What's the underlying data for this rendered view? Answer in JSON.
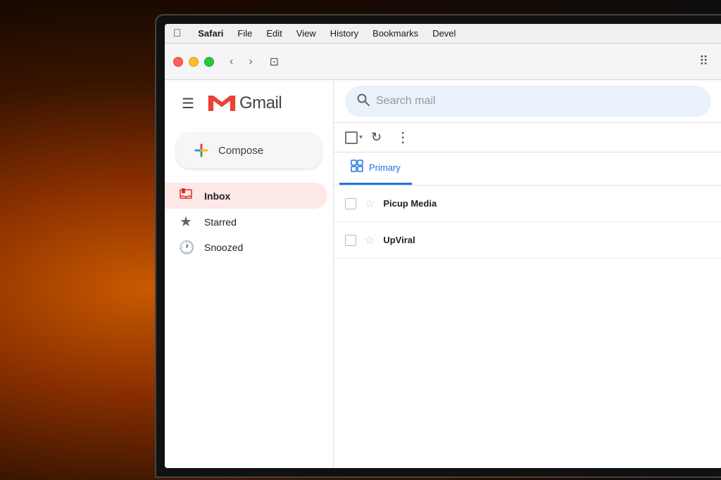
{
  "background": {
    "description": "warm fire glow background"
  },
  "menubar": {
    "apple_symbol": "&#xF8FF;",
    "items": [
      {
        "label": "Safari",
        "bold": true
      },
      {
        "label": "File"
      },
      {
        "label": "Edit"
      },
      {
        "label": "View"
      },
      {
        "label": "History"
      },
      {
        "label": "Bookmarks"
      },
      {
        "label": "Devel"
      }
    ]
  },
  "browser": {
    "back_btn": "‹",
    "forward_btn": "›",
    "sidebar_icon": "⊡",
    "grid_icon": "⠿"
  },
  "gmail": {
    "hamburger": "☰",
    "logo_text": "Gmail",
    "compose_label": "Compose",
    "search_placeholder": "Search mail",
    "nav_items": [
      {
        "id": "inbox",
        "label": "Inbox",
        "icon": "📪",
        "active": true
      },
      {
        "id": "starred",
        "label": "Starred",
        "icon": "★",
        "active": false
      },
      {
        "id": "snoozed",
        "label": "Snoozed",
        "icon": "🕐",
        "active": false
      }
    ],
    "toolbar": {
      "checkbox_label": "",
      "refresh_label": "↻",
      "more_label": "⋮"
    },
    "tabs": [
      {
        "label": "Primary",
        "icon": "⬛",
        "active": true
      }
    ],
    "emails": [
      {
        "sender": "Picup Media",
        "subject": "",
        "starred": false
      },
      {
        "sender": "UpViral",
        "subject": "",
        "starred": false
      }
    ]
  }
}
